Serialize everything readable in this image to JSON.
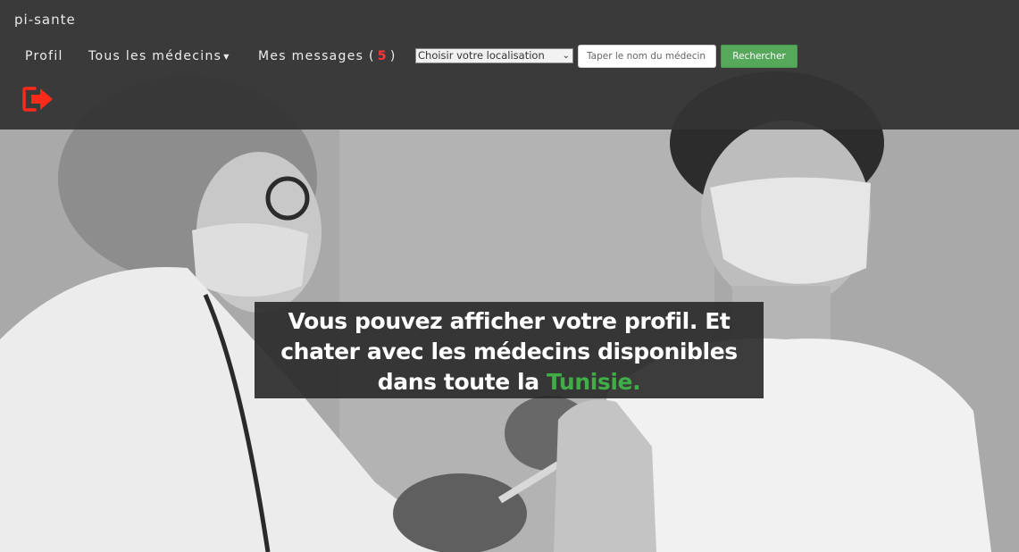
{
  "brand": "pi-sante",
  "nav": {
    "profil": "Profil",
    "medecins": "Tous les médecins",
    "messages_label": "Mes messages (",
    "messages_count": "5",
    "messages_close": ")"
  },
  "search": {
    "location_selected": "Choisir votre localisation",
    "doctor_placeholder": "Taper le nom du médecin",
    "button_label": "Rechercher"
  },
  "hero": {
    "text_part1": "Vous pouvez afficher votre profil. Et chater avec les médecins disponibles dans toute la",
    "text_highlight": "Tunisie."
  },
  "colors": {
    "navbar": "#343435",
    "accent_green": "#56a85b",
    "highlight_green": "#3fae46",
    "badge_red": "#ff3535",
    "logout_red": "#ff2a1a"
  },
  "icons": {
    "logout": "logout-icon",
    "dropdown": "chevron-down-icon"
  }
}
